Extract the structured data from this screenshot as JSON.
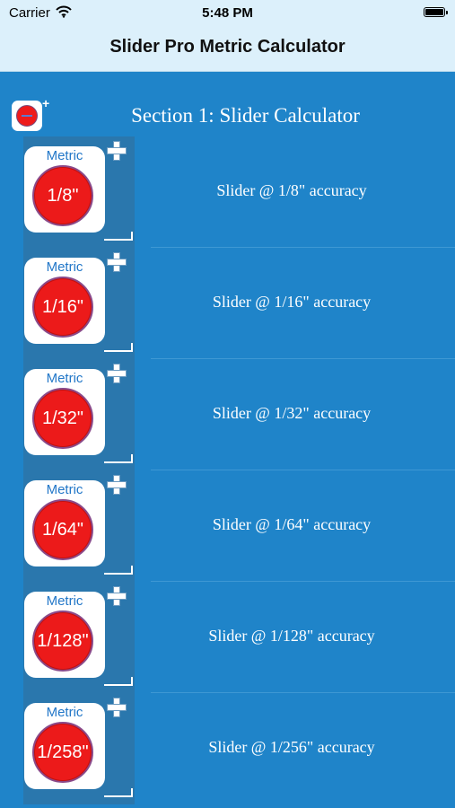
{
  "status_bar": {
    "carrier": "Carrier",
    "time": "5:48 PM",
    "battery_level": 1.0,
    "wifi_icon": "wifi-icon"
  },
  "nav": {
    "title": "Slider Pro Metric Calculator"
  },
  "section": {
    "title": "Section 1:  Slider Calculator",
    "add_symbol": "+"
  },
  "colors": {
    "background": "#1f84c9",
    "bar": "#dcf0fb",
    "strip": "#2a77ad",
    "circle": "#ec1a1a",
    "metric_text": "#2277c8"
  },
  "rows": [
    {
      "metric": "Metric",
      "fraction": "1/8\"",
      "label": "Slider @ 1/8\" accuracy"
    },
    {
      "metric": "Metric",
      "fraction": "1/16\"",
      "label": "Slider @ 1/16\" accuracy"
    },
    {
      "metric": "Metric",
      "fraction": "1/32\"",
      "label": "Slider @ 1/32\" accuracy"
    },
    {
      "metric": "Metric",
      "fraction": "1/64\"",
      "label": "Slider @ 1/64\" accuracy"
    },
    {
      "metric": "Metric",
      "fraction": "1/128\"",
      "label": "Slider @ 1/128\" accuracy"
    },
    {
      "metric": "Metric",
      "fraction": "1/258\"",
      "label": "Slider @ 1/256\" accuracy"
    }
  ]
}
